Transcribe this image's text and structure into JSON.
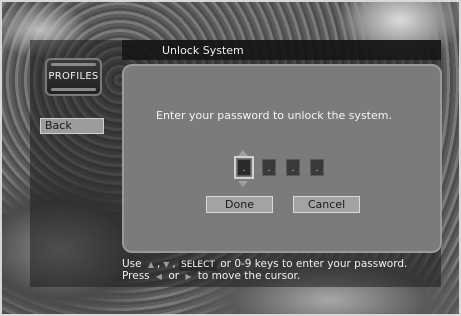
{
  "header": {
    "title": "Unlock System"
  },
  "sidebar": {
    "profiles_label": "PROFILES",
    "back_label": "Back"
  },
  "dialog": {
    "prompt": "Enter your password to unlock the system.",
    "digits": [
      ".",
      ".",
      ".",
      "."
    ],
    "active_digit": 0,
    "done_label": "Done",
    "cancel_label": "Cancel"
  },
  "help": {
    "line1_use": "Use",
    "line1_select": "SELECT",
    "line1_rest": "or 0-9 keys to enter your password.",
    "line2_press": "Press",
    "line2_or": "or",
    "line2_rest": "to move the cursor."
  },
  "icons": {
    "up": "up-arrow-icon",
    "down": "down-arrow-icon",
    "left": "left-arrow-icon",
    "right": "right-arrow-icon"
  }
}
